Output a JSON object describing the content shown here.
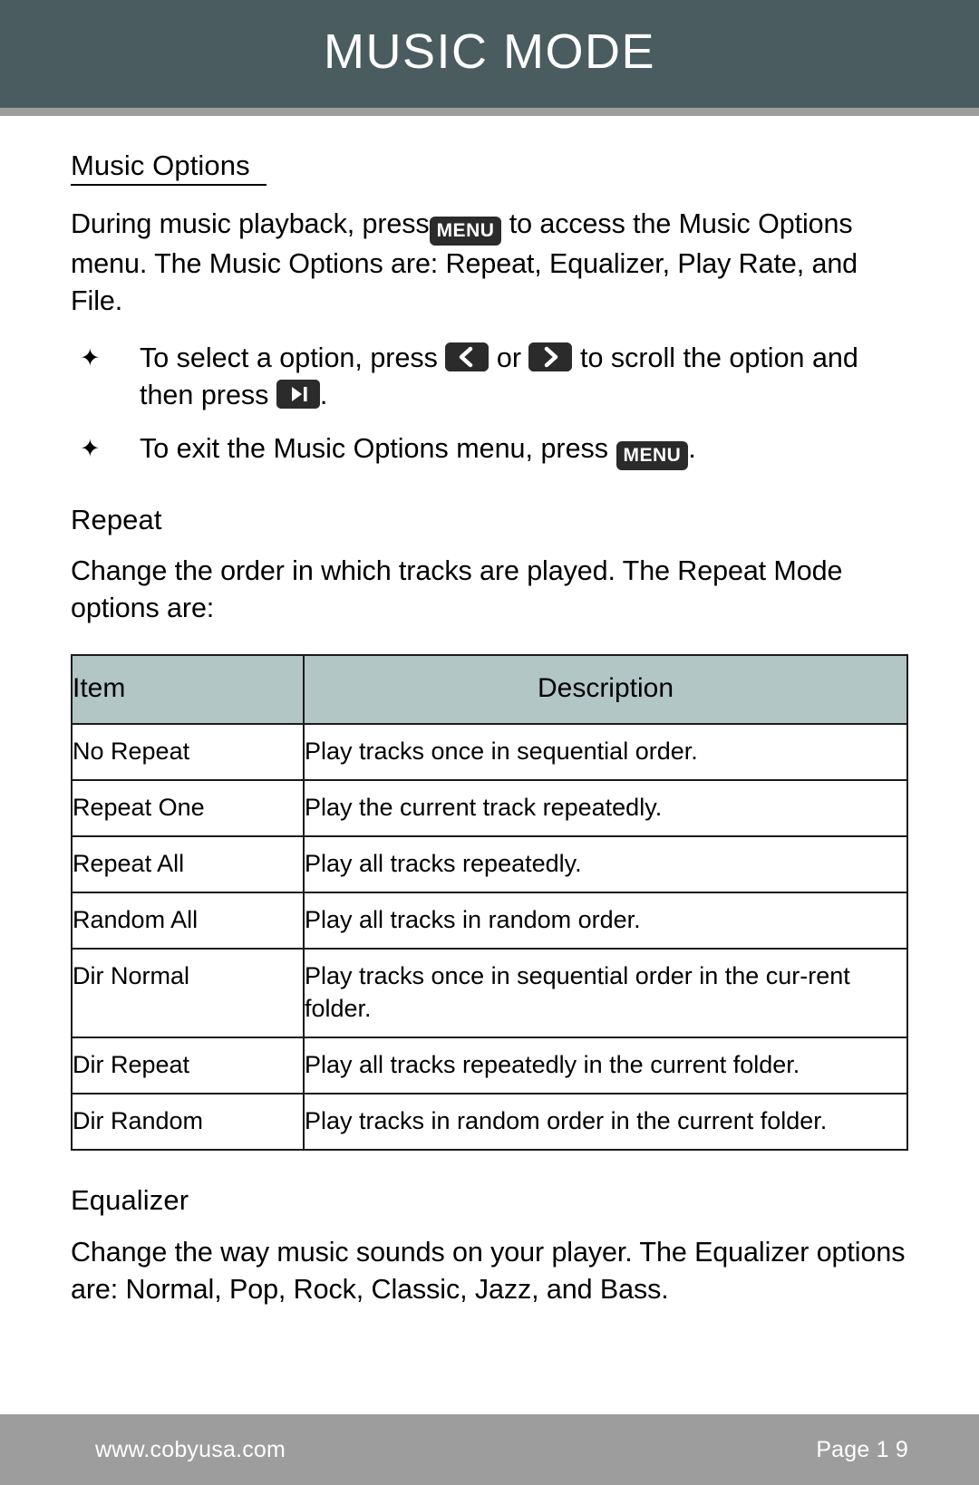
{
  "header": {
    "title": "MUSIC MODE",
    "bar_color": "#4a5c5f",
    "rule_color": "#9d9d9d"
  },
  "sections": {
    "music_options": {
      "heading": "Music Options",
      "intro_part1": "During music playback, press",
      "intro_key": "MENU",
      "intro_part2": "to access the Music Options menu. The Music Options are: Repeat, Equalizer, Play Rate, and File.",
      "bullets": [
        {
          "marker": "✦",
          "text_part1": "To select a option, press",
          "key1": "left-arrow",
          "conjunction": "or",
          "key2": "right-arrow",
          "text_part2": "to scroll the option and then press",
          "key3": "play-pause",
          "text_part3": "."
        },
        {
          "marker": "✦",
          "text_part1": "To exit the Music Options menu, press",
          "key1": "MENU",
          "text_part2": "."
        }
      ]
    },
    "repeat": {
      "heading": "Repeat",
      "body": "Change the order in which tracks are played. The Repeat Mode options are:",
      "table": {
        "columns": [
          "Item",
          "Description"
        ],
        "header_bg": "#b3c6c6",
        "rows": [
          [
            "No Repeat",
            "Play tracks once in sequential order."
          ],
          [
            "Repeat One",
            "Play the current track repeatedly."
          ],
          [
            "Repeat All",
            "Play all tracks repeatedly."
          ],
          [
            "Random All",
            "Play all tracks in random order."
          ],
          [
            "Dir Normal",
            "Play tracks once in sequential order in the cur-​rent folder."
          ],
          [
            "Dir Repeat",
            "Play all tracks repeatedly in the current folder."
          ],
          [
            "Dir Random",
            "Play tracks in random order in the current folder."
          ]
        ]
      }
    },
    "equalizer": {
      "heading": "Equalizer",
      "body": "Change the way music sounds on your player. The Equalizer options are: Normal, Pop, Rock, Classic, Jazz, and Bass."
    }
  },
  "footer": {
    "url": "www.cobyusa.com",
    "page": "Page 1 9",
    "bar_color": "#9d9d9d"
  }
}
